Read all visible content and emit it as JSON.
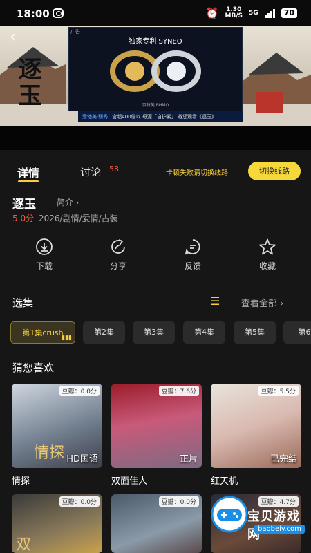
{
  "status": {
    "time": "18:00",
    "net_speed_value": "1.30",
    "net_speed_unit": "MB/S",
    "signal_label": "5G",
    "battery": "70"
  },
  "video": {
    "show_title": "逐玉",
    "ad": {
      "tag": "广告",
      "headline": "独家专利 SYNEO",
      "sub": "百特美 BHMO",
      "strip_brand": "爱他美·臻秀",
      "strip_text": "含超400倍以 母源「自护素」 邀您观看《逐玉》"
    }
  },
  "tabs": {
    "detail": "详情",
    "discuss": "讨论",
    "discuss_count": "58"
  },
  "route": {
    "hint": "卡顿失败请切换线路",
    "button": "切换线路"
  },
  "show": {
    "title": "逐玉",
    "brief": "简介 ›",
    "score": "5.0分",
    "meta": "2026/剧情/爱情/古装"
  },
  "actions": [
    {
      "label": "下载",
      "icon": "download-icon"
    },
    {
      "label": "分享",
      "icon": "share-icon"
    },
    {
      "label": "反馈",
      "icon": "feedback-icon"
    },
    {
      "label": "收藏",
      "icon": "star-icon"
    }
  ],
  "episodes": {
    "title": "选集",
    "view_all": "查看全部 ›",
    "items": [
      "第1集crush",
      "第2集",
      "第3集",
      "第4集",
      "第5集",
      "第6"
    ]
  },
  "recommend": {
    "title": "猜您喜欢",
    "cards": [
      {
        "title": "情探",
        "rating": "豆瓣：0.0分",
        "tag": "HD国语",
        "poster_text": "情探"
      },
      {
        "title": "双面佳人",
        "rating": "豆瓣：7.6分",
        "tag": "正片",
        "poster_text": ""
      },
      {
        "title": "红天机",
        "rating": "豆瓣：5.5分",
        "tag": "已完结",
        "poster_text": ""
      },
      {
        "title": "",
        "rating": "豆瓣：0.0分",
        "tag": "",
        "poster_text": "双"
      },
      {
        "title": "",
        "rating": "豆瓣：0.0分",
        "tag": "",
        "poster_text": ""
      },
      {
        "title": "",
        "rating": "豆瓣：4.7分",
        "tag": "",
        "poster_text": ""
      }
    ]
  },
  "watermark": {
    "text": "宝贝游戏网",
    "url": "baobeiy.com"
  },
  "colors": {
    "accent": "#f6cf3a",
    "background": "#161616",
    "score": "#ef5a45"
  }
}
